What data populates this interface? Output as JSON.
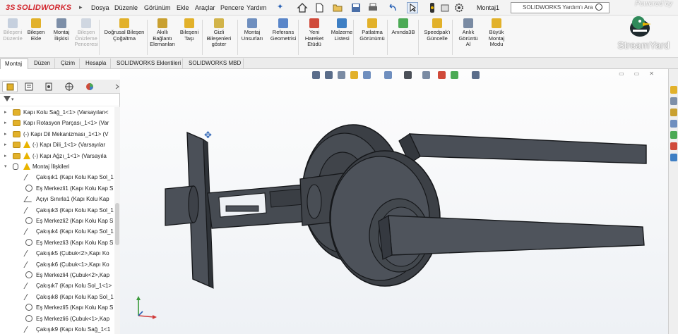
{
  "app": {
    "logo_ds": "3S",
    "logo_name": "SOLIDWORKS"
  },
  "menu": {
    "items": [
      "Dosya",
      "Düzenle",
      "Görünüm",
      "Ekle",
      "Araçlar",
      "Pencere",
      "Yardım"
    ],
    "document": "Montaj1",
    "search_placeholder": "SOLIDWORKS Yardım'ı Ara"
  },
  "ribbon": {
    "commands": [
      {
        "label": "Bileşeni Düzenle",
        "enabled": false,
        "color": "#8aa0bf"
      },
      {
        "label": "Bileşen Ekle",
        "enabled": true,
        "color": "#e2b12a"
      },
      {
        "label": "Montaj İlişkisi",
        "enabled": true,
        "color": "#7d8fa8"
      },
      {
        "label": "Bileşen Önizleme Penceresi",
        "enabled": false,
        "color": "#9fb0c6"
      },
      {
        "label": "Doğrusal Bileşen Çoğaltma",
        "enabled": true,
        "color": "#e2b12a"
      },
      {
        "label": "Akıllı Bağlantı Elemanları",
        "enabled": true,
        "color": "#c9a030"
      },
      {
        "label": "Bileşeni Taşı",
        "enabled": true,
        "color": "#e2b12a"
      },
      {
        "label": "Gizli Bileşenleri göster",
        "enabled": true,
        "color": "#d2b44a"
      },
      {
        "label": "Montaj Unsurları",
        "enabled": true,
        "color": "#6f8fbf"
      },
      {
        "label": "Referans Geometrisi",
        "enabled": true,
        "color": "#5a86c9"
      },
      {
        "label": "Yeni Hareket Etüdü",
        "enabled": true,
        "color": "#d04a3a"
      },
      {
        "label": "Malzeme Listesi",
        "enabled": true,
        "color": "#3e7fc4"
      },
      {
        "label": "Patlatma Görünümü",
        "enabled": true,
        "color": "#e2b12a"
      },
      {
        "label": "Anında3B",
        "enabled": true,
        "color": "#4caa55"
      },
      {
        "label": "Speedpak'ı Güncelle",
        "enabled": true,
        "color": "#e2b12a"
      },
      {
        "label": "Anlık Görüntü Al",
        "enabled": true,
        "color": "#7a8ba3"
      },
      {
        "label": "Büyük Montaj Modu",
        "enabled": true,
        "color": "#e2b12a"
      }
    ]
  },
  "tabs": [
    "Montaj",
    "Düzen",
    "Çizim",
    "Hesapla",
    "SOLIDWORKS Eklentileri",
    "SOLIDWORKS MBD"
  ],
  "active_tab": "Montaj",
  "feature_tree": {
    "nodes": [
      {
        "label": "Kapı Kolu Sağ_1<1> (Varsayılan<",
        "type": "component",
        "warning": false,
        "expand": "▸"
      },
      {
        "label": "Kapı Rotasyon Parçası_1<1> (Var",
        "type": "component",
        "warning": false,
        "expand": "▸"
      },
      {
        "label": "(-) Kapı Dil Mekanizması_1<1> (V",
        "type": "component",
        "warning": false,
        "expand": "▸"
      },
      {
        "label": "(-) Kapı Dili_1<1> (Varsayılar",
        "type": "component",
        "warning": true,
        "expand": "▸"
      },
      {
        "label": "(-) Kapı Ağzı_1<1> (Varsayıla",
        "type": "component",
        "warning": true,
        "expand": "▸"
      },
      {
        "label": "Montaj İlişkileri",
        "type": "mates",
        "warning": true,
        "expand": "▾"
      },
      {
        "label": "Çakışık1 (Kapı Kolu Kap Sol_1",
        "type": "coincident",
        "warning": false,
        "expand": ""
      },
      {
        "label": "Eş Merkezli1 (Kapı Kolu Kap S",
        "type": "concentric",
        "warning": false,
        "expand": ""
      },
      {
        "label": "Açıyı Sınırla1 (Kapı Kolu Kap",
        "type": "angle",
        "warning": false,
        "expand": ""
      },
      {
        "label": "Çakışık3 (Kapı Kolu Kap Sol_1",
        "type": "coincident",
        "warning": false,
        "expand": ""
      },
      {
        "label": "Eş Merkezli2 (Kapı Kolu Kap S",
        "type": "concentric",
        "warning": false,
        "expand": ""
      },
      {
        "label": "Çakışık4 (Kapı Kolu Kap Sol_1",
        "type": "coincident",
        "warning": false,
        "expand": ""
      },
      {
        "label": "Eş Merkezli3 (Kapı Kolu Kap S",
        "type": "concentric",
        "warning": false,
        "expand": ""
      },
      {
        "label": "Çakışık5 (Çubuk<2>,Kapı Ko",
        "type": "coincident",
        "warning": false,
        "expand": ""
      },
      {
        "label": "Çakışık6 (Çubuk<1>,Kapı Ko",
        "type": "coincident",
        "warning": false,
        "expand": ""
      },
      {
        "label": "Eş Merkezli4 (Çubuk<2>,Kap",
        "type": "concentric",
        "warning": false,
        "expand": ""
      },
      {
        "label": "Çakışık7 (Kapı Kolu Sol_1<1>",
        "type": "coincident",
        "warning": false,
        "expand": ""
      },
      {
        "label": "Çakışık8 (Kapı Kolu Kap Sol_1",
        "type": "coincident",
        "warning": false,
        "expand": ""
      },
      {
        "label": "Eş Merkezli5 (Kapı Kolu Kap S",
        "type": "concentric",
        "warning": false,
        "expand": ""
      },
      {
        "label": "Eş Merkezli6 (Çubuk<1>,Kap",
        "type": "concentric",
        "warning": false,
        "expand": ""
      },
      {
        "label": "Çakışık9 (Kapı Kolu Sağ_1<1",
        "type": "coincident",
        "warning": false,
        "expand": ""
      }
    ]
  },
  "watermark": {
    "powered": "Powered by",
    "brand": "StreamYard"
  },
  "colors": {
    "accent": "#2a62b5",
    "part": "#4b5058",
    "part_dark": "#2f3338",
    "part_edge": "#15171a",
    "warning": "#e9b400",
    "component": "#e2b12a"
  }
}
